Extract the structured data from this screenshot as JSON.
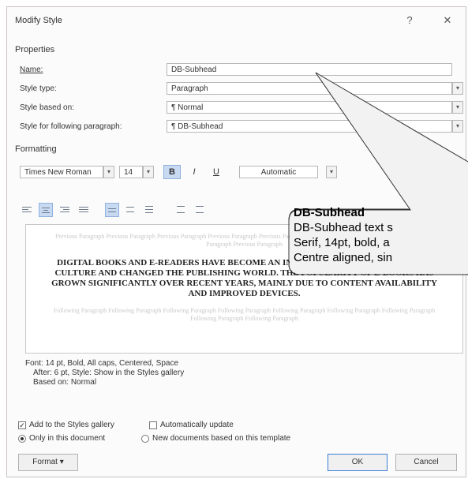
{
  "dialog": {
    "title": "Modify Style",
    "help_glyph": "?",
    "close_glyph": "✕"
  },
  "properties": {
    "group_label": "Properties",
    "name_label": "Name:",
    "name_value": "DB-Subhead",
    "style_type_label": "Style type:",
    "style_type_value": "Paragraph",
    "style_based_on_label": "Style based on:",
    "style_based_on_value": "¶  Normal",
    "following_label": "Style for following paragraph:",
    "following_value": "¶  DB-Subhead"
  },
  "formatting": {
    "group_label": "Formatting",
    "font": "Times New Roman",
    "size": "14",
    "bold": "B",
    "italic": "I",
    "underline": "U",
    "color": "Automatic"
  },
  "preview": {
    "ghost_before": "Previous Paragraph Previous Paragraph Previous Paragraph Previous Paragraph Previous Paragraph Previous Paragraph Previous Paragraph Previous Paragraph Previous Paragraph",
    "sample": "DIGITAL BOOKS AND E-READERS HAVE BECOME AN INTEGRAL PART OF OUR READING CULTURE AND CHANGED THE PUBLISHING WORLD. THE POPULARITY OF E-BOOKS HAS GROWN SIGNIFICANTLY OVER RECENT YEARS, MAINLY DUE TO CONTENT AVAILABILITY AND IMPROVED DEVICES.",
    "ghost_after": "Following Paragraph Following Paragraph Following Paragraph Following Paragraph Following Paragraph Following Paragraph Following Paragraph Following Paragraph Following Paragraph"
  },
  "description": {
    "line1": "Font: 14 pt, Bold, All caps, Centered, Space",
    "line2": "After:  6 pt, Style: Show in the Styles gallery",
    "line3": "Based on: Normal"
  },
  "options": {
    "add_gallery": "Add to the Styles gallery",
    "auto_update": "Automatically update",
    "only_doc": "Only in this document",
    "new_docs": "New documents based on this template"
  },
  "buttons": {
    "format": "Format ▾",
    "ok": "OK",
    "cancel": "Cancel"
  },
  "callout": {
    "heading": "DB-Subhead",
    "line1": "DB-Subhead text s",
    "line2": "Serif, 14pt, bold, a",
    "line3": "Centre aligned, sin"
  }
}
